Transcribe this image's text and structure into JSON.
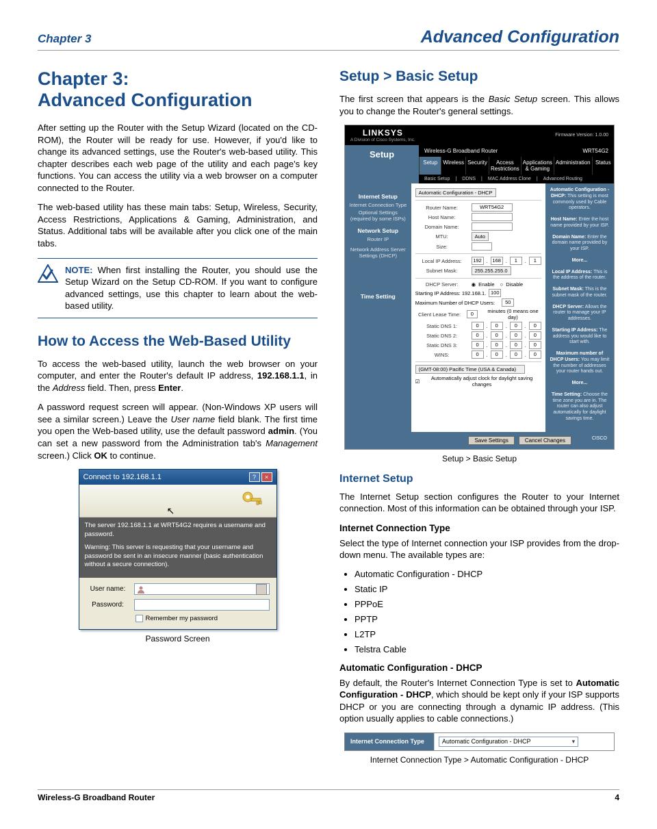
{
  "header": {
    "left": "Chapter 3",
    "right": "Advanced Configuration"
  },
  "title": "Chapter 3:\nAdvanced Configuration",
  "intro": {
    "p1": "After setting up the Router with the Setup Wizard (located on the CD-ROM), the Router will be ready for use. However, if you'd like to change its advanced settings, use the Router's web-based utility. This chapter describes each web page of the utility and each page's key functions. You can access the utility via a web browser on a computer connected to the Router.",
    "p2": "The web-based utility has these main tabs: Setup, Wireless, Security, Access Restrictions, Applications & Gaming, Administration, and Status. Additional tabs will be available after you click one of the main tabs."
  },
  "note": {
    "label": "NOTE:",
    "text": "When first installing the Router, you should use the Setup Wizard on the Setup CD-ROM. If you want to configure advanced settings, use this chapter to learn about the web-based utility."
  },
  "access": {
    "heading": "How to Access the Web-Based Utility",
    "p1_a": "To access the web-based utility, launch the web browser on your computer, and enter the Router's default IP address, ",
    "p1_ip": "192.168.1.1",
    "p1_b": ", in the ",
    "p1_addr": "Address",
    "p1_c": " field. Then, press ",
    "p1_enter": "Enter",
    "p1_d": ".",
    "p2_a": "A password request screen will appear. (Non-Windows XP users will see a similar screen.) Leave the ",
    "p2_user": "User name",
    "p2_b": " field blank. The first time you open the Web-based utility, use the default password ",
    "p2_pw": "admin",
    "p2_c": ". (You can set a new password from the Administration tab's ",
    "p2_mgmt": "Management",
    "p2_d": " screen.) Click ",
    "p2_ok": "OK",
    "p2_e": " to continue."
  },
  "pwd_dialog": {
    "title": "Connect to 192.168.1.1",
    "msg1": "The server 192.168.1.1 at WRT54G2 requires a username and password.",
    "msg2": "Warning: This server is requesting that your username and password be sent in an insecure manner (basic authentication without a secure connection).",
    "user_label": "User name:",
    "pass_label": "Password:",
    "remember": "Remember my password"
  },
  "pwd_caption": "Password Screen",
  "setup": {
    "heading": "Setup > Basic Setup",
    "p1_a": "The first screen that appears is the ",
    "p1_i": "Basic Setup",
    "p1_b": " screen. This allows you to change the Router's general settings."
  },
  "router_shot": {
    "logo": "LINKSYS",
    "logo_sub": "A Division of Cisco Systems, Inc.",
    "fw": "Firmware Version: 1.0.00",
    "product": "Wireless-G Broadband Router",
    "model": "WRT54G2",
    "tab_main": "Setup",
    "tabs": [
      "Setup",
      "Wireless",
      "Security",
      "Access Restrictions",
      "Applications & Gaming",
      "Administration",
      "Status"
    ],
    "subtabs": [
      "Basic Setup",
      "DDNS",
      "MAC Address Clone",
      "Advanced Routing"
    ],
    "left": {
      "s1": "Internet Setup",
      "s1a": "Internet Connection Type",
      "s1b": "Optional Settings (required by some ISPs)",
      "s2": "Network Setup",
      "s2a": "Router IP",
      "s2b": "Network Address Server Settings (DHCP)",
      "s3": "Time Setting"
    },
    "mid": {
      "conn": "Automatic Configuration - DHCP",
      "hostname": "Host Name:",
      "domain": "Domain Name:",
      "mtu": "MTU:",
      "mtu_val": "Auto",
      "size": "Size:",
      "router_name_l": "Router Name:",
      "router_name": "WRT54G2",
      "local_ip_l": "Local IP Address:",
      "local_ip": [
        "192",
        "168",
        "1",
        "1"
      ],
      "subnet_l": "Subnet Mask:",
      "subnet": "255.255.255.0",
      "dhcp_l": "DHCP Server:",
      "dhcp_en": "Enable",
      "dhcp_dis": "Disable",
      "start_ip_l": "Starting IP Address: 192.168.1.",
      "start_ip": "100",
      "max_l": "Maximum Number of DHCP Users:",
      "max": "50",
      "lease_l": "Client Lease Time:",
      "lease": "0",
      "lease_note": "minutes (0 means one day)",
      "dns1": "Static DNS 1:",
      "dns2": "Static DNS 2:",
      "dns3": "Static DNS 3:",
      "wins": "WINS:",
      "zero": [
        "0",
        "0",
        "0",
        "0"
      ],
      "tz": "(GMT-08:00) Pacific Time (USA & Canada)",
      "auto_dst": "Automatically adjust clock for daylight saving changes"
    },
    "right": {
      "r1_t": "Automatic Configuration - DHCP:",
      "r1": "This setting is most commonly used by Cable operators.",
      "r2_t": "Host Name:",
      "r2": "Enter the host name provided by your ISP.",
      "r3_t": "Domain Name:",
      "r3": "Enter the domain name provided by your ISP.",
      "r4": "More...",
      "r5_t": "Local IP Address:",
      "r5": "This is the address of the router.",
      "r6_t": "Subnet Mask:",
      "r6": "This is the subnet mask of the router.",
      "r7_t": "DHCP Server:",
      "r7": "Allows the router to manage your IP addresses.",
      "r8_t": "Starting IP Address:",
      "r8": "The address you would like to start with.",
      "r9_t": "Maximum number of DHCP Users:",
      "r9": "You may limit the number of addresses your router hands out.",
      "r10": "More...",
      "r11_t": "Time Setting:",
      "r11": "Choose the time zone you are in. The router can also adjust automatically for daylight savings time."
    },
    "btn_save": "Save Settings",
    "btn_cancel": "Cancel Changes",
    "cisco": "CISCO"
  },
  "router_caption": "Setup > Basic Setup",
  "internet": {
    "heading": "Internet Setup",
    "p1": "The Internet Setup section configures the Router to your Internet connection. Most of this information can be obtained through your ISP.",
    "sub": "Internet Connection Type",
    "p2": "Select the type of Internet connection your ISP provides from the drop-down menu. The available types are:",
    "types": [
      "Automatic Configuration - DHCP",
      "Static IP",
      "PPPoE",
      "PPTP",
      "L2TP",
      "Telstra Cable"
    ],
    "auto_h": "Automatic Configuration - DHCP",
    "auto_a": "By default, the Router's Internet Connection Type is set to ",
    "auto_b": "Automatic Configuration - DHCP",
    "auto_c": ", which should be kept only if your ISP supports DHCP or you are connecting through a dynamic IP address. (This option usually applies to cable connections.)"
  },
  "ict": {
    "label": "Internet Connection Type",
    "value": "Automatic Configuration - DHCP",
    "caption": "Internet Connection Type > Automatic Configuration - DHCP"
  },
  "footer": {
    "left": "Wireless-G Broadband Router",
    "right": "4"
  }
}
